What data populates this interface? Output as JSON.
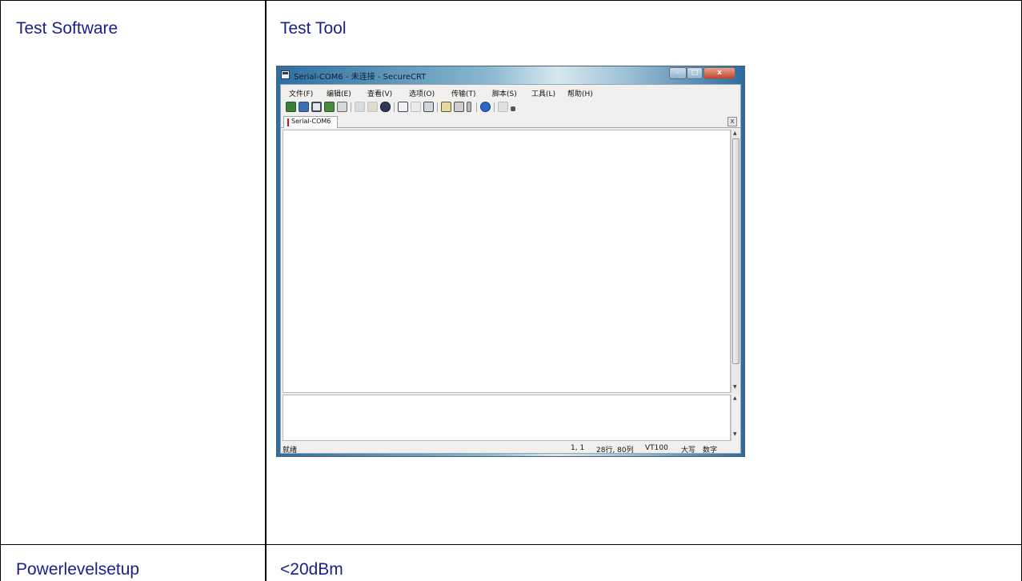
{
  "table": {
    "row1_col1": "Test Software",
    "row1_col2": "Test Tool",
    "row2_col1": "Powerlevelsetup",
    "row2_col2": "<20dBm"
  },
  "app": {
    "title": "Serial-COM6 - 未连接 - SecureCRT",
    "window_buttons": {
      "minimize": "–",
      "maximize": "□",
      "close": "x"
    },
    "menu": [
      "文件(F)",
      "编辑(E)",
      "查看(V)",
      "选项(O)",
      "传输(T)",
      "脚本(S)",
      "工具(L)",
      "帮助(H)"
    ],
    "toolbar_icons": [
      "connect-icon",
      "quick-connect-icon",
      "connect-tab-icon",
      "reconnect-icon",
      "disconnect-icon",
      "copy-icon",
      "paste-icon",
      "find-icon",
      "print-icon",
      "print-selection-icon",
      "print-setup-icon",
      "session-options-icon",
      "global-options-icon",
      "key-icon",
      "help-icon",
      "map-keys-icon"
    ],
    "tab_label": "Serial-COM6",
    "tab_close": "x",
    "status": {
      "ready": "就绪",
      "position": "1,  1",
      "size": "28行, 80列",
      "emulation": "VT100",
      "caps": "大写",
      "num": "数字"
    }
  }
}
